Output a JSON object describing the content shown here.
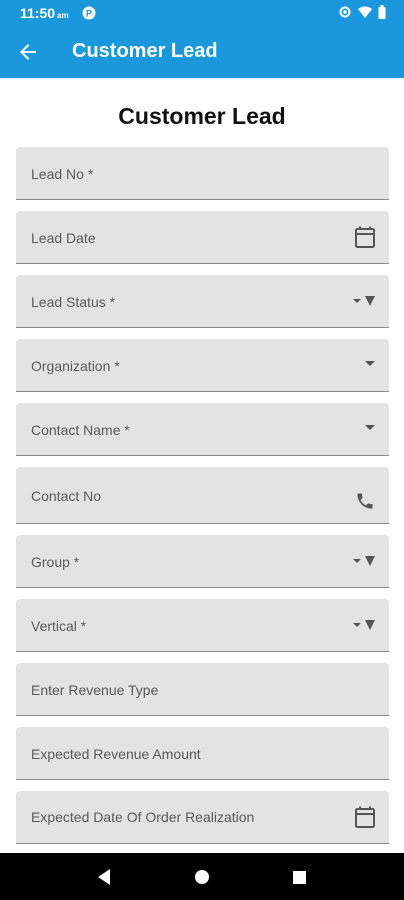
{
  "status_bar": {
    "time": "11:50",
    "ampm": "am"
  },
  "app_bar": {
    "title": "Customer Lead"
  },
  "form": {
    "title": "Customer Lead",
    "fields": [
      {
        "label": "Lead No *"
      },
      {
        "label": "Lead Date",
        "icon": "calendar-icon"
      },
      {
        "label": "Lead Status *",
        "icon": "dropdown-arrow-icon"
      },
      {
        "label": "Organization *",
        "icon": "dropdown-arrow-icon"
      },
      {
        "label": "Contact Name *",
        "icon": "dropdown-arrow-icon"
      },
      {
        "label": "Contact No",
        "icon": "phone-icon"
      },
      {
        "label": "Group *",
        "icon": "dropdown-arrow-icon"
      },
      {
        "label": "Vertical *",
        "icon": "dropdown-arrow-icon"
      },
      {
        "label": "Enter Revenue Type"
      },
      {
        "label": "Expected Revenue Amount"
      },
      {
        "label": "Expected Date Of Order Realization",
        "icon": "calendar-icon"
      }
    ]
  },
  "colors": {
    "app_bar": "#1b97dc",
    "field_bg": "#e3e3e3",
    "nav_bar": "#000000"
  }
}
